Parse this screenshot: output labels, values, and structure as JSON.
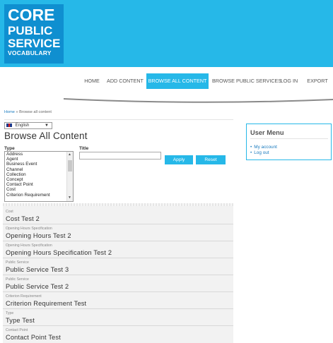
{
  "colors": {
    "accent": "#26b8e8",
    "logo_bg": "#0f8fd0",
    "link": "#1a7bbf"
  },
  "logo": {
    "line1": "CORE",
    "line2": "PUBLIC",
    "line3": "SERVICE",
    "line4": "VOCABULARY"
  },
  "nav": {
    "items": [
      {
        "label": "HOME"
      },
      {
        "label": "ADD CONTENT"
      },
      {
        "label": "BROWSE ALL CONTENT",
        "active": true
      },
      {
        "label": "BROWSE PUBLIC SERVICES"
      },
      {
        "label": "LOG IN"
      },
      {
        "label": "EXPORT"
      }
    ]
  },
  "breadcrumb": {
    "home": "Home",
    "separator": "»",
    "current": "Browse all content"
  },
  "language": {
    "selected": "English",
    "icon": "uk-flag-icon"
  },
  "page_title": "Browse All Content",
  "filters": {
    "type_label": "Type",
    "type_options": [
      "Address",
      "Agent",
      "Business Event",
      "Channel",
      "Collection",
      "Concept",
      "Contact Point",
      "Cost",
      "Criterion Requirement"
    ],
    "title_label": "Title",
    "title_value": "",
    "apply_label": "Apply",
    "reset_label": "Reset"
  },
  "results": [
    {
      "type": "Cost",
      "title": "Cost Test 2"
    },
    {
      "type": "Opening Hours Specification",
      "title": "Opening Hours Test 2"
    },
    {
      "type": "Opening Hours Specification",
      "title": "Opening Hours Specification Test 2"
    },
    {
      "type": "Public Service",
      "title": "Public Service Test 3"
    },
    {
      "type": "Public Service",
      "title": "Public Service Test 2"
    },
    {
      "type": "Criterion Requirement",
      "title": "Criterion Requirement Test"
    },
    {
      "type": "Type",
      "title": "Type Test"
    },
    {
      "type": "Contact Point",
      "title": "Contact Point Test"
    }
  ],
  "user_menu": {
    "title": "User Menu",
    "items": [
      "My account",
      "Log out"
    ]
  }
}
